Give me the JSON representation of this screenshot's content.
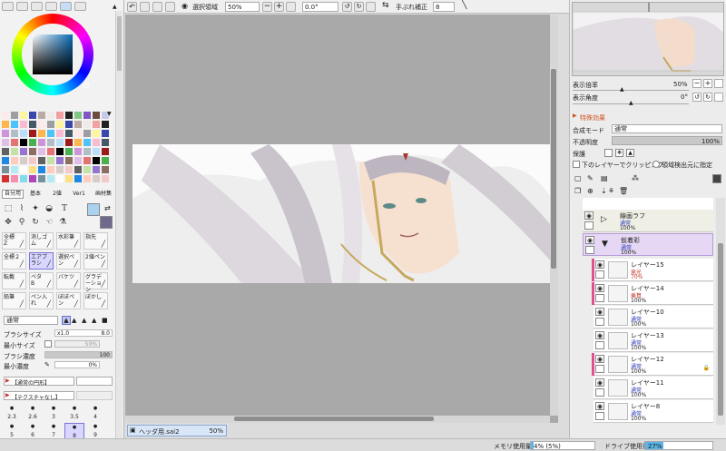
{
  "toolbar": {
    "select_label": "選択領域",
    "zoom": "50%",
    "rotation": "0.0°",
    "stabilizer_label": "手ぶれ補正",
    "stabilizer_value": "8"
  },
  "tool_tabs": [
    "自分用",
    "基本",
    "2値",
    "Ver1",
    "画材集"
  ],
  "brushes": [
    {
      "name": "全標",
      "sub": "Z"
    },
    {
      "name": "消しゴム",
      "sub": ""
    },
    {
      "name": "水彩筆",
      "sub": ""
    },
    {
      "name": "指先",
      "sub": ""
    },
    {
      "name": "全標２",
      "sub": ""
    },
    {
      "name": "エアブラシ",
      "sub": ""
    },
    {
      "name": "選択ペン",
      "sub": ""
    },
    {
      "name": "2値ペン",
      "sub": ""
    },
    {
      "name": "転載",
      "sub": ""
    },
    {
      "name": "ベタ",
      "sub": "B"
    },
    {
      "name": "バケツ",
      "sub": ""
    },
    {
      "name": "グラデーション",
      "sub": ""
    },
    {
      "name": "鉛筆",
      "sub": ""
    },
    {
      "name": "ペン入れ",
      "sub": ""
    },
    {
      "name": "ぼぼペン",
      "sub": ""
    },
    {
      "name": "ぼかし",
      "sub": ""
    }
  ],
  "brush_props": {
    "mode": "通常",
    "size_label": "ブラシサイズ",
    "size_mult": "x1.0",
    "size_value": "8.0",
    "min_size_label": "最小サイズ",
    "min_size_value": "50%",
    "density_label": "ブラシ濃度",
    "density_value": "100",
    "min_density_label": "最小濃度",
    "min_density_value": "0%",
    "shape_label": "【通常の円形】",
    "texture_label": "【テクスチャなし】"
  },
  "brush_sizes": [
    "2.3",
    "2.6",
    "3",
    "3.5",
    "4",
    "5",
    "6",
    "7",
    "8",
    "9"
  ],
  "document_tab": {
    "name": "ヘッダ用.sai2",
    "zoom": "50%"
  },
  "navigator": {
    "zoom_label": "表示倍率",
    "zoom_value": "50%",
    "angle_label": "表示角度",
    "angle_value": "0°"
  },
  "effects_label": "特殊効果",
  "layer_props": {
    "blend_label": "合成モード",
    "blend_value": "通常",
    "opacity_label": "不透明度",
    "opacity_value": "100%",
    "protect_label": "保護",
    "clip_label": "下のレイヤーでクリッピング",
    "detect_label": "領域検出元に指定"
  },
  "layers": [
    {
      "name": "",
      "mode": "",
      "opacity": "100%",
      "kind": "partial"
    },
    {
      "name": "線画ラフ",
      "mode": "通常",
      "opacity": "100%",
      "kind": "folder"
    },
    {
      "name": "仮着彩",
      "mode": "通常",
      "opacity": "100%",
      "kind": "folder-selected"
    },
    {
      "name": "レイヤー15",
      "mode": "発光",
      "opacity": "70%",
      "kind": "clip"
    },
    {
      "name": "レイヤー14",
      "mode": "乗算",
      "opacity": "100%",
      "kind": "clip"
    },
    {
      "name": "レイヤー10",
      "mode": "通常",
      "opacity": "100%",
      "kind": "normal"
    },
    {
      "name": "レイヤー13",
      "mode": "通常",
      "opacity": "100%",
      "kind": "normal"
    },
    {
      "name": "レイヤー12",
      "mode": "通常",
      "opacity": "100%",
      "kind": "clip-locked"
    },
    {
      "name": "レイヤー11",
      "mode": "通常",
      "opacity": "100%",
      "kind": "normal"
    },
    {
      "name": "レイヤー8",
      "mode": "通常",
      "opacity": "100%",
      "kind": "normal"
    }
  ],
  "status": {
    "memory_label": "メモリ使用量",
    "memory_value": "4% (5%)",
    "drive_label": "ドライブ使用量",
    "drive_value": "27%"
  }
}
